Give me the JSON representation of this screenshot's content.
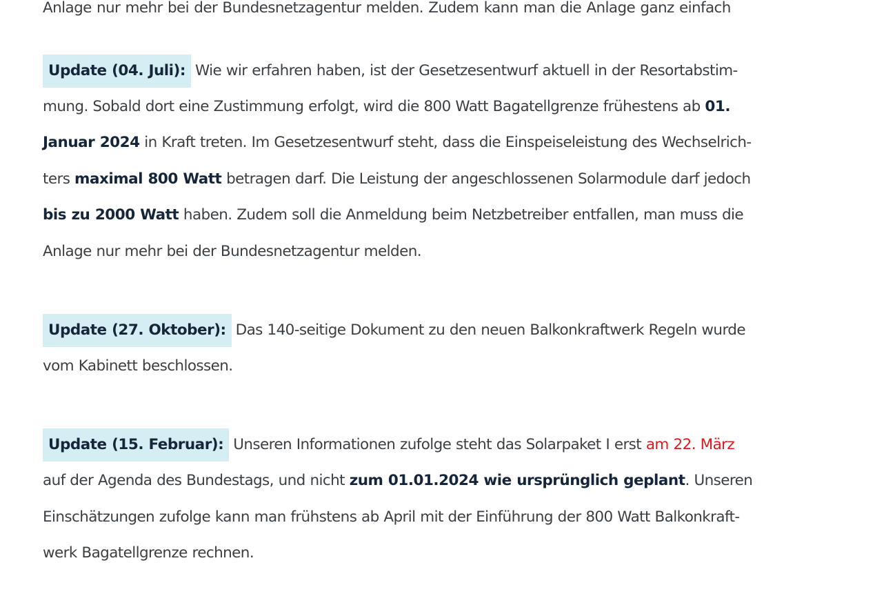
{
  "top_cut_line": "Anlage    nur    mehr    bei    der    Bundesnetzagentur    melden.   Zudem    kann    man    die    Anlage    ganz    einfach",
  "updates": [
    {
      "label": "Update (04. Juli):",
      "lines": [
        [
          "Wie wir erfahren haben, ist der Gesetzesentwurf aktuell in der Resortabstim-"
        ],
        [
          "mung. Sobald dort eine Zustimmung erfolgt, wird die 800 Watt Bagatellgrenze frühestens ab ",
          "01."
        ],
        [
          "Januar 2024",
          " in Kraft treten. Im Gesetzesentwurf steht, dass die Einspeiseleistung des Wechselrich-"
        ],
        [
          "ters ",
          "maximal 800 Watt",
          " betragen darf. Die Leistung der angeschlossenen Solarmodule darf jedoch"
        ],
        [
          "bis zu 2000 Watt",
          " haben. Zudem soll die Anmeldung beim Netzbetreiber entfallen, man muss die"
        ],
        [
          "Anlage nur mehr bei der Bundesnetzagentur melden."
        ]
      ]
    },
    {
      "label": "Update (27. Oktober):",
      "lines": [
        [
          "Das 140-seitige Dokument zu den neuen Balkonkraftwerk Regeln wurde"
        ],
        [
          "vom Kabinett beschlossen."
        ]
      ]
    },
    {
      "label": "Update (15. Februar):",
      "lines": [
        [
          "Unseren Informationen zufolge steht das Solarpaket I erst ",
          "am 22. März"
        ],
        [
          "auf der Agenda des Bundestags, und nicht ",
          "zum 01.01.2024 wie ursprünglich geplant",
          ". Unseren"
        ],
        [
          "Einschätzungen zufolge kann man frühstens ab April mit der Einführung der 800 Watt Balkonkraft-"
        ],
        [
          "werk Bagatellgrenze rechnen."
        ]
      ]
    }
  ],
  "colors": {
    "badge_background": "#d4eef3",
    "emphasis_text": "#15253a",
    "body_text": "#3a3f44",
    "highlight_red": "#e0191f"
  }
}
